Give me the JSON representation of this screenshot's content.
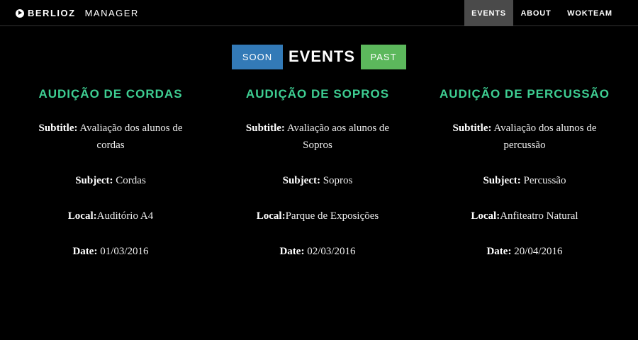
{
  "nav": {
    "brand_bold": "BERLIOZ",
    "brand_light": "MANAGER",
    "links": [
      {
        "label": "EVENTS",
        "active": true
      },
      {
        "label": "ABOUT",
        "active": false
      },
      {
        "label": "WOKTEAM",
        "active": false
      }
    ]
  },
  "header": {
    "soon_label": "SOON",
    "title": "EVENTS",
    "past_label": "PAST"
  },
  "colors": {
    "soon": "#337ab7",
    "past": "#5cb85c",
    "event_title": "#3ecf93"
  },
  "events": [
    {
      "title": "AUDIÇÃO DE CORDAS",
      "subtitle_label": "Subtitle:",
      "subtitle": " Avaliação dos alunos de cordas",
      "subject_label": "Subject:",
      "subject": " Cordas",
      "local_label": "Local:",
      "local": "Auditório A4",
      "date_label": "Date:",
      "date": " 01/03/2016"
    },
    {
      "title": "AUDIÇÃO DE SOPROS",
      "subtitle_label": "Subtitle:",
      "subtitle": " Avaliação aos alunos de Sopros",
      "subject_label": "Subject:",
      "subject": " Sopros",
      "local_label": "Local:",
      "local": "Parque de Exposições",
      "date_label": "Date:",
      "date": " 02/03/2016"
    },
    {
      "title": "AUDIÇÃO DE PERCUSSÃO",
      "subtitle_label": "Subtitle:",
      "subtitle": " Avaliação dos alunos de percussão",
      "subject_label": "Subject:",
      "subject": " Percussão",
      "local_label": "Local:",
      "local": "Anfiteatro Natural",
      "date_label": "Date:",
      "date": " 20/04/2016"
    }
  ]
}
